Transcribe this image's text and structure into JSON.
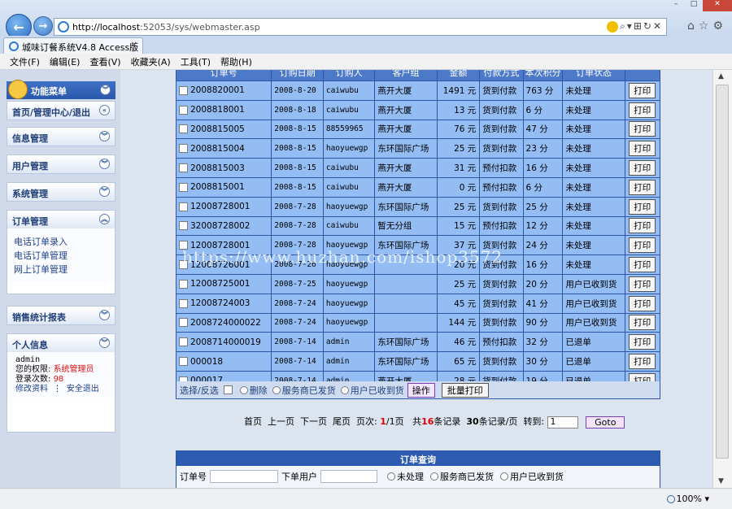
{
  "browser": {
    "url_host": "http://localhost",
    "url_rest": ":52053/sys/webmaster.asp",
    "tab_title": "城味订餐系统V4.8 Access版",
    "menu": [
      "文件(F)",
      "编辑(E)",
      "查看(V)",
      "收藏夹(A)",
      "工具(T)",
      "帮助(H)"
    ],
    "zoom": "100%"
  },
  "sidebar": {
    "header": "功能菜单",
    "home_link": "首页/管理中心/退出",
    "sections": [
      "信息管理",
      "用户管理",
      "系统管理"
    ],
    "order_mgmt": {
      "title": "订单管理",
      "links": [
        "电话订单录入",
        "电话订单管理",
        "网上订单管理"
      ]
    },
    "sales": "销售统计报表",
    "personal": {
      "title": "个人信息",
      "username": "admin",
      "role_label": "您的权限:",
      "role_value": "系统管理员",
      "login_label": "登录次数:",
      "login_value": "98",
      "edit_link": "修改资料",
      "logout_link": "安全退出"
    }
  },
  "table": {
    "headers": [
      "订单号",
      "订购日期",
      "订购人",
      "客户组",
      "金额",
      "付款方式",
      "本次积分",
      "订单状态",
      ""
    ],
    "print_label": "打印",
    "rows": [
      [
        "2008820001",
        "2008-8-20",
        "caiwubu",
        "燕开大厦",
        "1491 元",
        "货到付款",
        "763 分",
        "未处理"
      ],
      [
        "2008818001",
        "2008-8-18",
        "caiwubu",
        "燕开大厦",
        "13 元",
        "货到付款",
        "6 分",
        "未处理"
      ],
      [
        "2008815005",
        "2008-8-15",
        "88559965",
        "燕开大厦",
        "76 元",
        "货到付款",
        "47 分",
        "未处理"
      ],
      [
        "2008815004",
        "2008-8-15",
        "haoyuewgp",
        "东环国际广场",
        "25 元",
        "货到付款",
        "23 分",
        "未处理"
      ],
      [
        "2008815003",
        "2008-8-15",
        "caiwubu",
        "燕开大厦",
        "31 元",
        "预付扣款",
        "16 分",
        "未处理"
      ],
      [
        "2008815001",
        "2008-8-15",
        "caiwubu",
        "燕开大厦",
        "0 元",
        "预付扣款",
        "6 分",
        "未处理"
      ],
      [
        "12008728001",
        "2008-7-28",
        "haoyuewgp",
        "东环国际广场",
        "25 元",
        "货到付款",
        "25 分",
        "未处理"
      ],
      [
        "32008728002",
        "2008-7-28",
        "caiwubu",
        "暂无分组",
        "15 元",
        "预付扣款",
        "12 分",
        "未处理"
      ],
      [
        "12008728001",
        "2008-7-28",
        "haoyuewgp",
        "东环国际广场",
        "37 元",
        "货到付款",
        "24 分",
        "未处理"
      ],
      [
        "12008726001",
        "2008-7-26",
        "haoyuewgp",
        "",
        "20 元",
        "货到付款",
        "16 分",
        "未处理"
      ],
      [
        "12008725001",
        "2008-7-25",
        "haoyuewgp",
        "",
        "25 元",
        "货到付款",
        "20 分",
        "用户已收到货"
      ],
      [
        "12008724003",
        "2008-7-24",
        "haoyuewgp",
        "",
        "45 元",
        "货到付款",
        "41 分",
        "用户已收到货"
      ],
      [
        "2008724000022",
        "2008-7-24",
        "haoyuewgp",
        "",
        "144 元",
        "货到付款",
        "90 分",
        "用户已收到货"
      ],
      [
        "2008714000019",
        "2008-7-14",
        "admin",
        "东环国际广场",
        "46 元",
        "预付扣款",
        "32 分",
        "已退单"
      ],
      [
        "000018",
        "2008-7-14",
        "admin",
        "东环国际广场",
        "65 元",
        "货到付款",
        "30 分",
        "已退单"
      ],
      [
        "000017",
        "2008-7-14",
        "admin",
        "燕开大厦",
        "28 元",
        "货到付款",
        "19 分",
        "已退单"
      ]
    ]
  },
  "footer": {
    "select_label": "选择/反选",
    "delete_label": "删除",
    "radio_shipped": "服务商已发货",
    "radio_received": "用户已收到货",
    "operate_btn": "操作",
    "batch_print_btn": "批量打印"
  },
  "pager": {
    "first": "首页",
    "prev": "上一页",
    "next": "下一页",
    "last": "尾页",
    "page_label": "页次:",
    "page_current": "1",
    "page_total": "/1页",
    "total_prefix": "共",
    "total_count": "16",
    "total_suffix": "条记录",
    "per_page_count": "30",
    "per_page_suffix": "条记录/页",
    "goto_label": "转到:",
    "goto_value": "1",
    "goto_btn": "Goto"
  },
  "query": {
    "title": "订单查询",
    "order_no_label": "订单号",
    "user_label": "下单用户",
    "radio_pending": "未处理",
    "radio_shipped": "服务商已发货",
    "radio_received": "用户已收到货"
  },
  "watermark": "https://www.huzhan.com/ishop3572"
}
